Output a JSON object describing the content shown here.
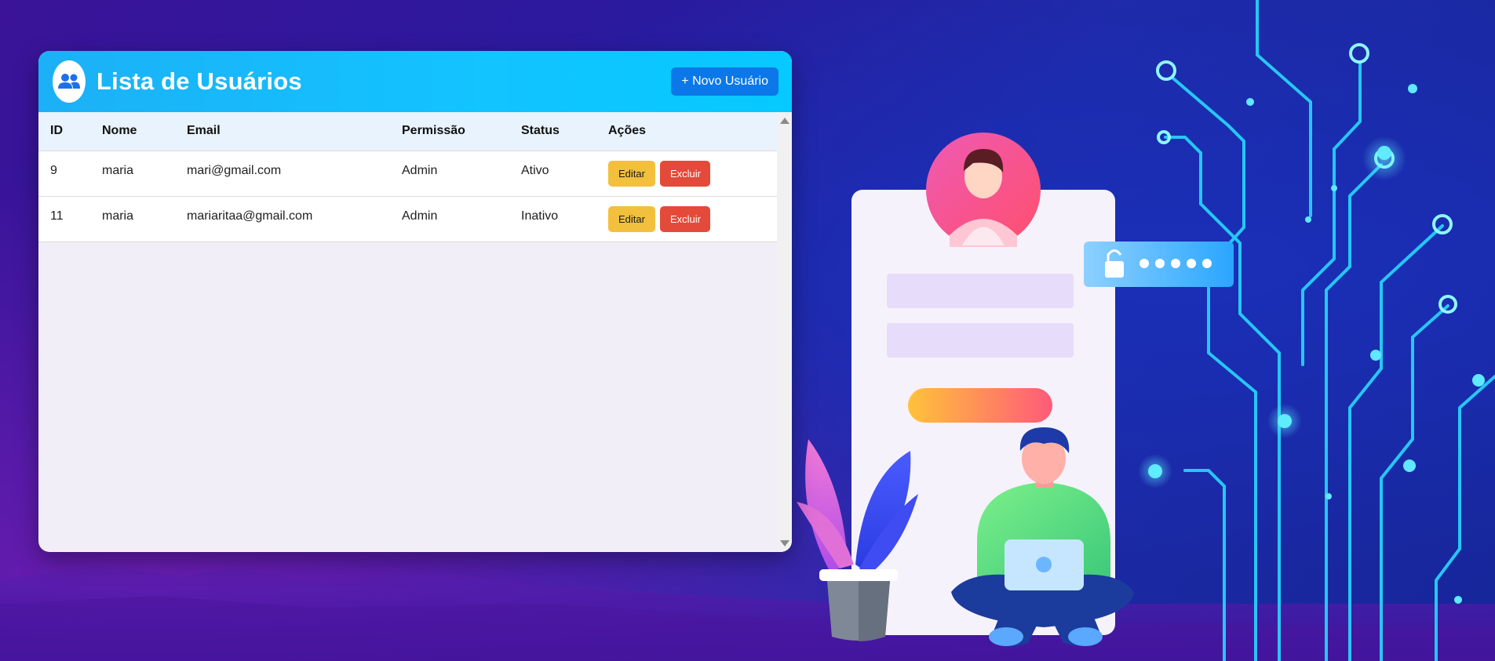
{
  "header": {
    "title": "Lista de Usuários",
    "new_user_label": "+ Novo Usuário",
    "avatar_icon": "users-icon"
  },
  "table": {
    "columns": [
      "ID",
      "Nome",
      "Email",
      "Permissão",
      "Status",
      "Ações"
    ],
    "rows": [
      {
        "id": "9",
        "name": "maria",
        "email": "mari@gmail.com",
        "permission": "Admin",
        "status": "Ativo",
        "edit_label": "Editar",
        "delete_label": "Excluir"
      },
      {
        "id": "11",
        "name": "maria",
        "email": "mariaritaa@gmail.com",
        "permission": "Admin",
        "status": "Inativo",
        "edit_label": "Editar",
        "delete_label": "Excluir"
      }
    ]
  },
  "colors": {
    "header_gradient_start": "#1cb0f6",
    "header_gradient_end": "#06c9ff",
    "primary_button": "#0b77e8",
    "edit_button": "#f2c03c",
    "delete_button": "#e34a3a"
  },
  "illustration": {
    "lock_icon": "padlock-icon"
  }
}
